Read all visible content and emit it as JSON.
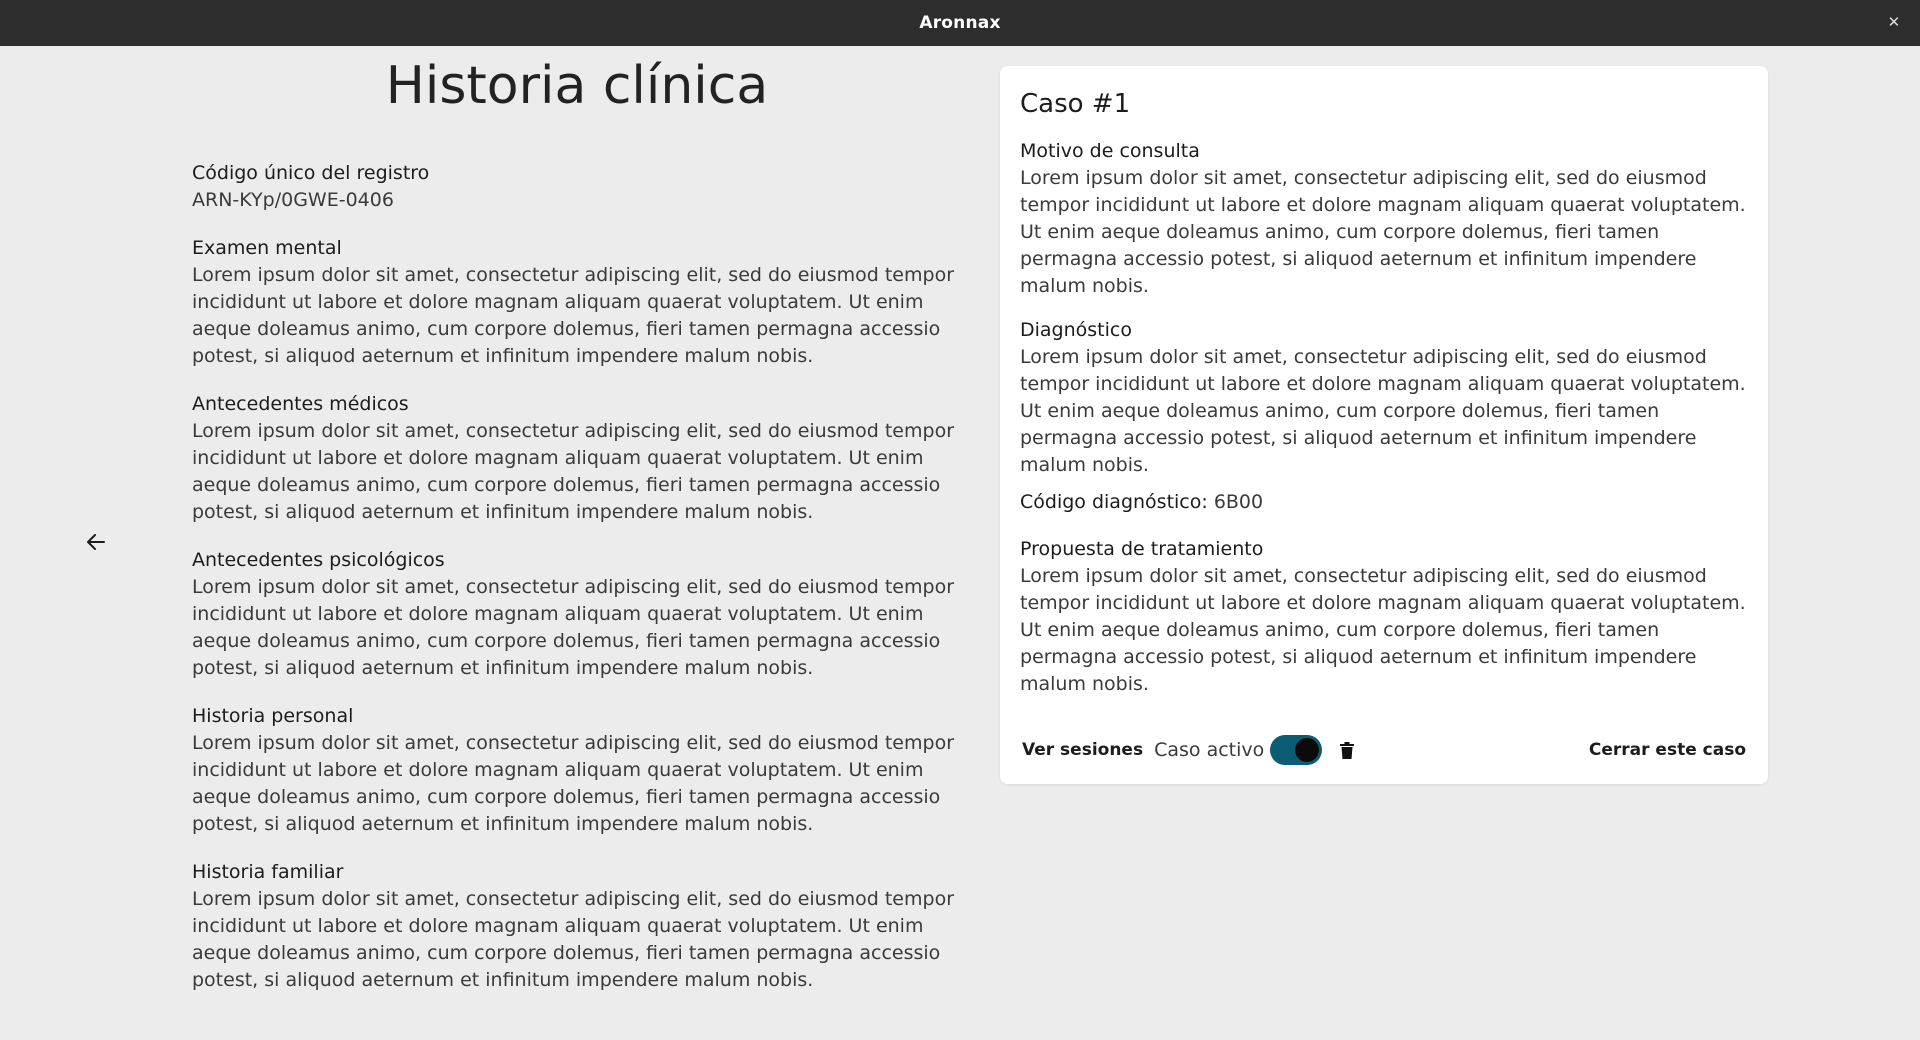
{
  "window": {
    "title": "Aronnax",
    "close_glyph": "✕"
  },
  "page": {
    "title": "Historia clínica",
    "back_icon": "arrow-left-icon"
  },
  "record": {
    "code_label": "Código único del registro",
    "code_value": "ARN-KYp/0GWE-0406",
    "sections": [
      {
        "label": "Examen mental",
        "text": "Lorem ipsum dolor sit amet, consectetur adipiscing elit, sed do eiusmod tempor incididunt ut labore et dolore magnam aliquam quaerat voluptatem. Ut enim aeque doleamus animo, cum corpore dolemus, fieri tamen permagna accessio potest, si aliquod aeternum et infinitum impendere malum nobis."
      },
      {
        "label": "Antecedentes médicos",
        "text": "Lorem ipsum dolor sit amet, consectetur adipiscing elit, sed do eiusmod tempor incididunt ut labore et dolore magnam aliquam quaerat voluptatem. Ut enim aeque doleamus animo, cum corpore dolemus, fieri tamen permagna accessio potest, si aliquod aeternum et infinitum impendere malum nobis."
      },
      {
        "label": "Antecedentes psicológicos",
        "text": "Lorem ipsum dolor sit amet, consectetur adipiscing elit, sed do eiusmod tempor incididunt ut labore et dolore magnam aliquam quaerat voluptatem. Ut enim aeque doleamus animo, cum corpore dolemus, fieri tamen permagna accessio potest, si aliquod aeternum et infinitum impendere malum nobis."
      },
      {
        "label": "Historia personal",
        "text": "Lorem ipsum dolor sit amet, consectetur adipiscing elit, sed do eiusmod tempor incididunt ut labore et dolore magnam aliquam quaerat voluptatem. Ut enim aeque doleamus animo, cum corpore dolemus, fieri tamen permagna accessio potest, si aliquod aeternum et infinitum impendere malum nobis."
      },
      {
        "label": "Historia familiar",
        "text": "Lorem ipsum dolor sit amet, consectetur adipiscing elit, sed do eiusmod tempor incididunt ut labore et dolore magnam aliquam quaerat voluptatem. Ut enim aeque doleamus animo, cum corpore dolemus, fieri tamen permagna accessio potest, si aliquod aeternum et infinitum impendere malum nobis."
      }
    ]
  },
  "case": {
    "title": "Caso #1",
    "reason_label": "Motivo de consulta",
    "reason_text": "Lorem ipsum dolor sit amet, consectetur adipiscing elit, sed do eiusmod tempor incididunt ut labore et dolore magnam aliquam quaerat voluptatem. Ut enim aeque doleamus animo, cum corpore dolemus, fieri tamen permagna accessio potest, si aliquod aeternum et infinitum impendere malum nobis.",
    "diagnosis_label": "Diagnóstico",
    "diagnosis_text": "Lorem ipsum dolor sit amet, consectetur adipiscing elit, sed do eiusmod tempor incididunt ut labore et dolore magnam aliquam quaerat voluptatem. Ut enim aeque doleamus animo, cum corpore dolemus, fieri tamen permagna accessio potest, si aliquod aeternum et infinitum impendere malum nobis.",
    "diagnosis_code_label": "Código diagnóstico:",
    "diagnosis_code_value": "6B00",
    "treatment_label": "Propuesta de tratamiento",
    "treatment_text": "Lorem ipsum dolor sit amet, consectetur adipiscing elit, sed do eiusmod tempor incididunt ut labore et dolore magnam aliquam quaerat voluptatem. Ut enim aeque doleamus animo, cum corpore dolemus, fieri tamen permagna accessio potest, si aliquod aeternum et infinitum impendere malum nobis.",
    "sessions_button": "Ver sesiones",
    "active_label": "Caso activo",
    "active_on": true,
    "delete_icon": "trash-icon",
    "close_case_button": "Cerrar este caso"
  },
  "colors": {
    "titlebar": "#2d2d2d",
    "background": "#ececec",
    "card": "#ffffff",
    "toggle_track": "#0a5d73",
    "toggle_knob": "#0b0b0b"
  }
}
